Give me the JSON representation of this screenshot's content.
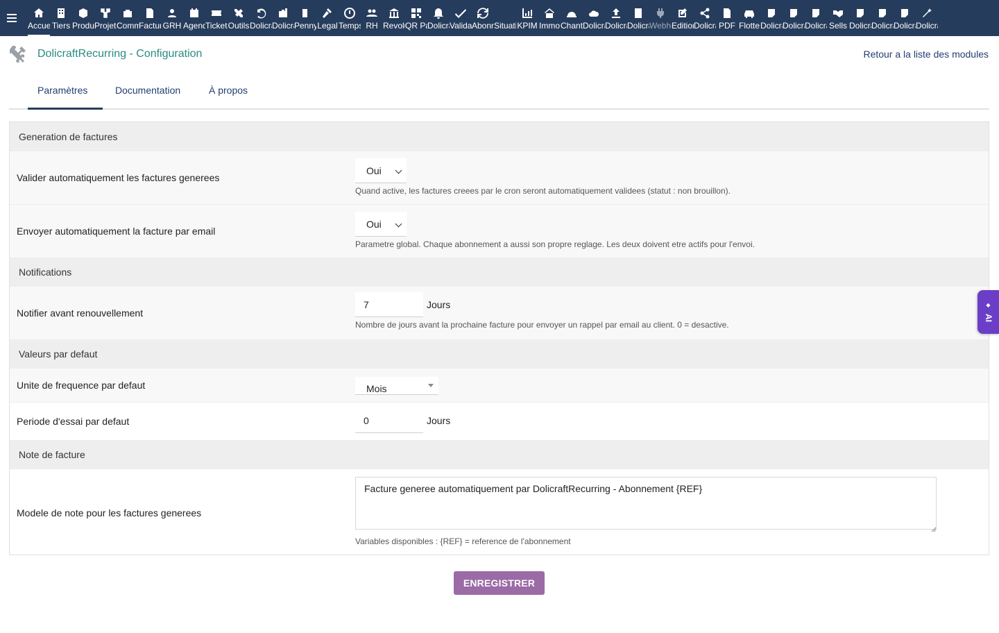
{
  "topbar": {
    "items": [
      {
        "label": "Accueil",
        "icon": "home-icon",
        "active": true
      },
      {
        "label": "Tiers",
        "icon": "building-icon"
      },
      {
        "label": "Produits",
        "icon": "cube-icon"
      },
      {
        "label": "Projets",
        "icon": "project-icon"
      },
      {
        "label": "Commercial",
        "icon": "briefcase-icon"
      },
      {
        "label": "Facturation",
        "icon": "invoice-icon"
      },
      {
        "label": "GRH",
        "icon": "users-icon"
      },
      {
        "label": "Agenda",
        "icon": "calendar-icon"
      },
      {
        "label": "Tickets",
        "icon": "ticket-icon"
      },
      {
        "label": "Outils",
        "icon": "tools-icon"
      },
      {
        "label": "Dolicraft",
        "icon": "undo-icon"
      },
      {
        "label": "Dolicraft",
        "icon": "case-icon"
      },
      {
        "label": "Pennylane",
        "icon": "document-icon"
      },
      {
        "label": "Legal",
        "icon": "gavel-icon"
      },
      {
        "label": "Temps",
        "icon": "clock-icon"
      },
      {
        "label": "RH",
        "icon": "group-icon"
      },
      {
        "label": "Revolut",
        "icon": "bank-icon"
      },
      {
        "label": "QR Pay",
        "icon": "qrcode-icon"
      },
      {
        "label": "Dolicraft",
        "icon": "bell-icon"
      },
      {
        "label": "Validation",
        "icon": "check-icon"
      },
      {
        "label": "Abonnements",
        "icon": "refresh-icon"
      },
      {
        "label": "Situation",
        "icon": "blank-icon"
      },
      {
        "label": "KPIM",
        "icon": "chart-icon"
      },
      {
        "label": "Immo",
        "icon": "house-icon"
      },
      {
        "label": "Chantier",
        "icon": "helmet-icon"
      },
      {
        "label": "Dolicraft",
        "icon": "cloud-icon"
      },
      {
        "label": "Dolicraft",
        "icon": "upload-icon"
      },
      {
        "label": "Dolicraft",
        "icon": "office-icon"
      },
      {
        "label": "Webhooks",
        "icon": "plug-icon",
        "dim": true
      },
      {
        "label": "Editions",
        "icon": "edit-icon"
      },
      {
        "label": "Dolicraft",
        "icon": "share-icon"
      },
      {
        "label": "PDF",
        "icon": "pdf-icon"
      },
      {
        "label": "Flotte",
        "icon": "car-icon"
      },
      {
        "label": "Dolicraft",
        "icon": "note-icon"
      },
      {
        "label": "Dolicraft",
        "icon": "note-icon"
      },
      {
        "label": "Dolicraft",
        "icon": "note-icon"
      },
      {
        "label": "Sells",
        "icon": "handshake-icon"
      },
      {
        "label": "Dolicraft",
        "icon": "note-icon"
      },
      {
        "label": "Dolicraft",
        "icon": "note-icon"
      },
      {
        "label": "Dolicraft",
        "icon": "note-icon"
      },
      {
        "label": "Dolicraft",
        "icon": "magic-icon"
      }
    ]
  },
  "header": {
    "module_icon": "tools-icon",
    "title": "DolicraftRecurring - Configuration",
    "back_link": "Retour a la liste des modules"
  },
  "tabs": [
    {
      "label": "Paramètres",
      "active": true
    },
    {
      "label": "Documentation"
    },
    {
      "label": "À propos"
    }
  ],
  "sections": {
    "invoices": "Generation de factures",
    "notifications": "Notifications",
    "defaults": "Valeurs par defaut",
    "note": "Note de facture"
  },
  "settings": {
    "auto_validate": {
      "label": "Valider automatiquement les factures generees",
      "value": "Oui",
      "help": "Quand active, les factures creees par le cron seront automatiquement validees (statut : non brouillon)."
    },
    "auto_email": {
      "label": "Envoyer automatiquement la facture par email",
      "value": "Oui",
      "help": "Parametre global. Chaque abonnement a aussi son propre reglage. Les deux doivent etre actifs pour l'envoi."
    },
    "notify_before": {
      "label": "Notifier avant renouvellement",
      "value": "7",
      "unit": "Jours",
      "help": "Nombre de jours avant la prochaine facture pour envoyer un rappel par email au client. 0 = desactive."
    },
    "frequency_unit": {
      "label": "Unite de frequence par defaut",
      "value": "Mois"
    },
    "trial_period": {
      "label": "Periode d'essai par defaut",
      "value": "0",
      "unit": "Jours"
    },
    "note_template": {
      "label": "Modele de note pour les factures generees",
      "value": "Facture generee automatiquement par DolicraftRecurring - Abonnement {REF}",
      "help": "Variables disponibles : {REF} = reference de l'abonnement"
    }
  },
  "save_button": "ENREGISTRER",
  "ai_tab": {
    "label": "AI",
    "icon": "sparkle-icon"
  }
}
